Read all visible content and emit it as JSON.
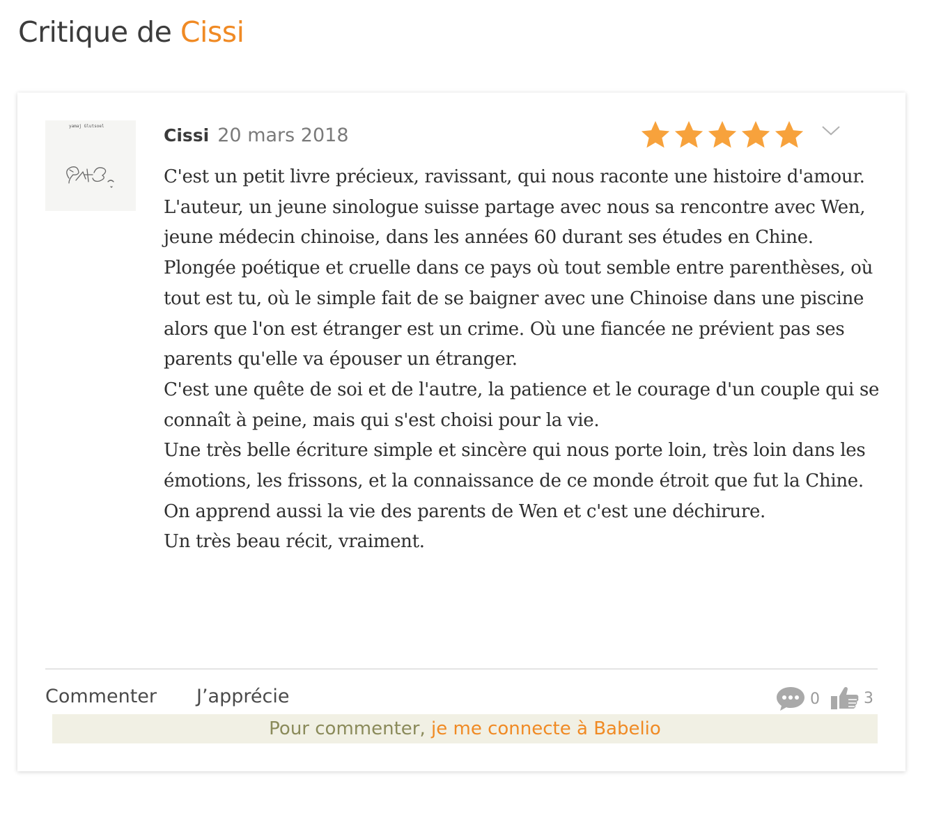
{
  "page": {
    "title_prefix": "Critique de ",
    "title_user": "Cissi"
  },
  "review": {
    "author": "Cissi",
    "date": "20 mars 2018",
    "rating": 5,
    "max_rating": 5,
    "avatar_caption": "yamaj Glutsoel",
    "paragraphs": [
      "C'est un petit livre précieux, ravissant, qui nous raconte une histoire d'amour.",
      "L'auteur, un jeune sinologue suisse partage avec nous sa rencontre avec Wen, jeune médecin chinoise, dans les années 60 durant ses études en Chine.",
      "Plongée poétique et cruelle dans ce pays où tout semble entre parenthèses, où tout est tu, où le simple fait de se baigner avec une Chinoise dans une piscine alors que l'on est étranger est un crime. Où une fiancée ne prévient pas ses parents qu'elle va épouser un étranger.",
      "C'est une quête de soi et de l'autre, la patience et le courage d'un couple qui se connaît à peine, mais qui s'est choisi pour la vie.",
      "Une très belle écriture simple et sincère qui nous porte loin, très loin dans les émotions, les frissons, et la connaissance de ce monde étroit que fut la Chine.",
      "On apprend aussi la vie des parents de Wen et c'est une déchirure.",
      "Un très beau récit, vraiment."
    ]
  },
  "actions": {
    "comment_label": "Commenter",
    "like_label": "J’apprécie",
    "comments_count": "0",
    "likes_count": "3"
  },
  "login_prompt": {
    "text": "Pour commenter, ",
    "link": "je me connecte à Babelio"
  },
  "icons": {
    "stars": "star-icon",
    "menu": "chevron-down-icon",
    "comments": "speech-bubble-icon",
    "likes": "thumbs-up-icon"
  },
  "colors": {
    "accent": "#f08a24",
    "star": "#f7a23c",
    "login_bar_bg": "#f1f0e4",
    "login_text": "#8a8a5a"
  }
}
